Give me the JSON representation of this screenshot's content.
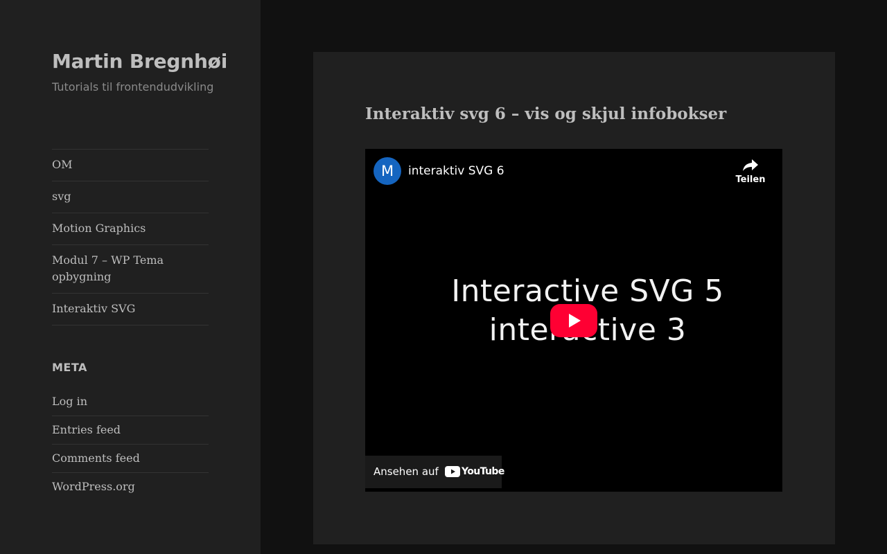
{
  "site": {
    "title": "Martin Bregnhøi",
    "description": "Tutorials til frontendudvikling"
  },
  "menu": {
    "items": [
      {
        "label": "OM"
      },
      {
        "label": "svg"
      },
      {
        "label": "Motion Graphics"
      },
      {
        "label": "Modul 7 – WP Tema opbygning"
      },
      {
        "label": "Interaktiv SVG"
      }
    ]
  },
  "meta": {
    "title": "META",
    "links": [
      {
        "label": "Log in"
      },
      {
        "label": "Entries feed"
      },
      {
        "label": "Comments feed"
      },
      {
        "label": "WordPress.org"
      }
    ]
  },
  "article": {
    "title": "Interaktiv svg 6 – vis og skjul infobokser"
  },
  "video": {
    "channel_initial": "M",
    "title": "interaktiv SVG 6",
    "share_label": "Teilen",
    "thumbnail_line1": "Interactive SVG 5",
    "thumbnail_line2": "interactive 3",
    "watch_on": "Ansehen auf",
    "youtube_wordmark": "YouTube",
    "colors": {
      "avatar": "#1565c0",
      "play_button": "#ff0033"
    }
  }
}
